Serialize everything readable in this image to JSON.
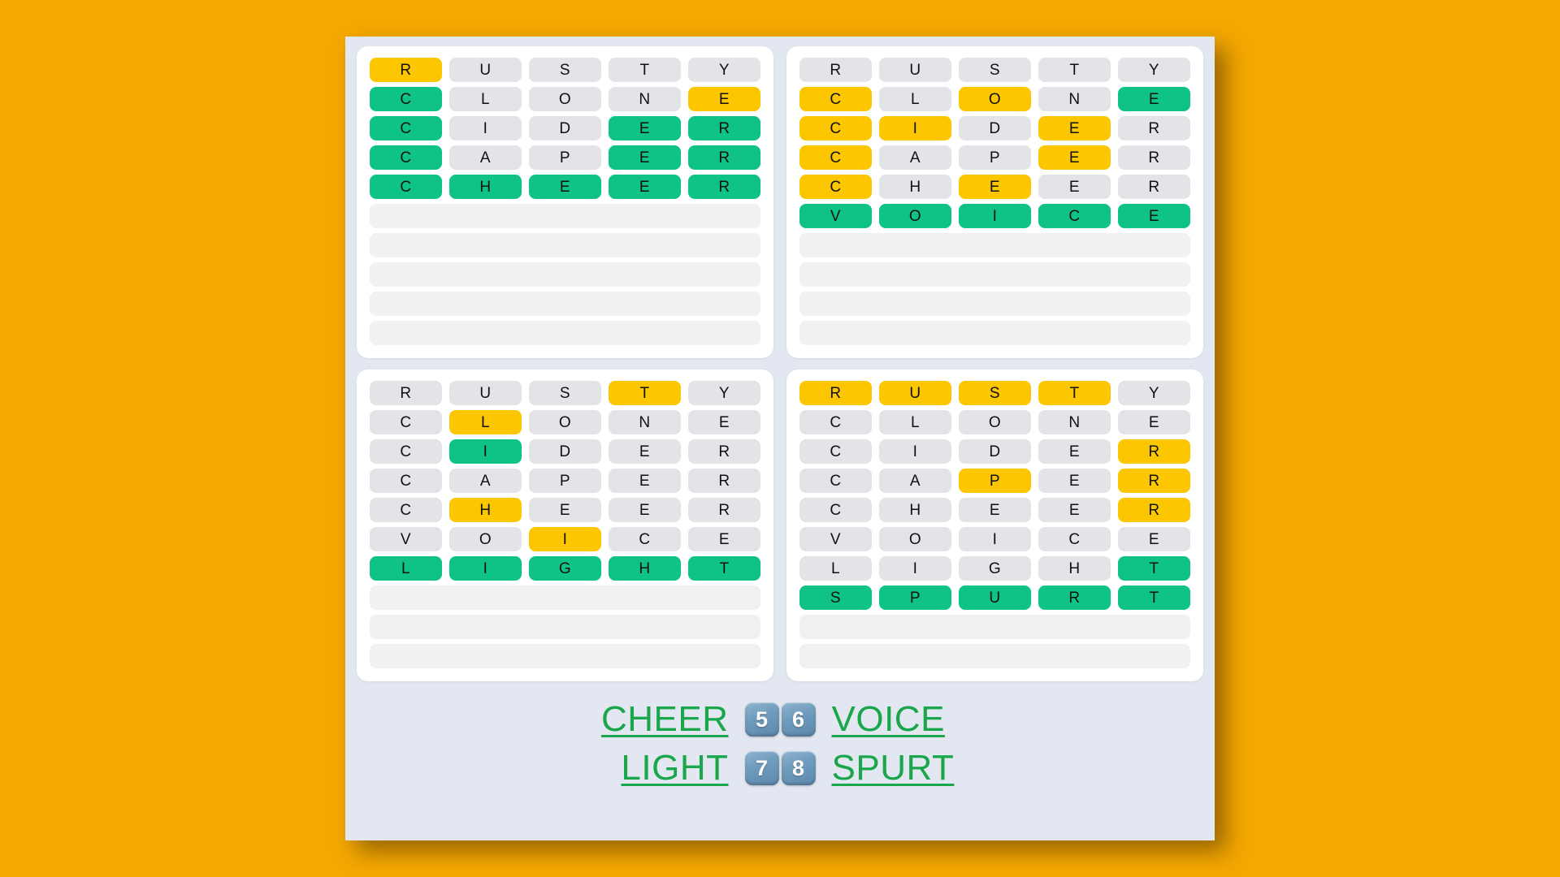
{
  "theme": {
    "page_background": "#f5a800",
    "board_background": "#e3e7f1",
    "card_background": "#ffffff",
    "tile_absent": "#e2e4e8",
    "tile_present": "#fcc700",
    "tile_correct": "#0ec384",
    "blank_row": "#f1f1f1",
    "answer_text": "#1aa64b",
    "badge_text": "#ffffff"
  },
  "boards": [
    {
      "name": "board-1",
      "answer": "CHEER",
      "guess_count": 5,
      "max_rows": 10,
      "rows": [
        {
          "word": "RUSTY",
          "letters": [
            "R",
            "U",
            "S",
            "T",
            "Y"
          ],
          "states": [
            "present",
            "absent",
            "absent",
            "absent",
            "absent"
          ]
        },
        {
          "word": "CLONE",
          "letters": [
            "C",
            "L",
            "O",
            "N",
            "E"
          ],
          "states": [
            "correct",
            "absent",
            "absent",
            "absent",
            "present"
          ]
        },
        {
          "word": "CIDER",
          "letters": [
            "C",
            "I",
            "D",
            "E",
            "R"
          ],
          "states": [
            "correct",
            "absent",
            "absent",
            "correct",
            "correct"
          ]
        },
        {
          "word": "CAPER",
          "letters": [
            "C",
            "A",
            "P",
            "E",
            "R"
          ],
          "states": [
            "correct",
            "absent",
            "absent",
            "correct",
            "correct"
          ]
        },
        {
          "word": "CHEER",
          "letters": [
            "C",
            "H",
            "E",
            "E",
            "R"
          ],
          "states": [
            "correct",
            "correct",
            "correct",
            "correct",
            "correct"
          ]
        }
      ]
    },
    {
      "name": "board-2",
      "answer": "VOICE",
      "guess_count": 6,
      "max_rows": 10,
      "rows": [
        {
          "word": "RUSTY",
          "letters": [
            "R",
            "U",
            "S",
            "T",
            "Y"
          ],
          "states": [
            "absent",
            "absent",
            "absent",
            "absent",
            "absent"
          ]
        },
        {
          "word": "CLONE",
          "letters": [
            "C",
            "L",
            "O",
            "N",
            "E"
          ],
          "states": [
            "present",
            "absent",
            "present",
            "absent",
            "correct"
          ]
        },
        {
          "word": "CIDER",
          "letters": [
            "C",
            "I",
            "D",
            "E",
            "R"
          ],
          "states": [
            "present",
            "present",
            "absent",
            "present",
            "absent"
          ]
        },
        {
          "word": "CAPER",
          "letters": [
            "C",
            "A",
            "P",
            "E",
            "R"
          ],
          "states": [
            "present",
            "absent",
            "absent",
            "present",
            "absent"
          ]
        },
        {
          "word": "CHEER",
          "letters": [
            "C",
            "H",
            "E",
            "E",
            "R"
          ],
          "states": [
            "present",
            "absent",
            "present",
            "absent",
            "absent"
          ]
        },
        {
          "word": "VOICE",
          "letters": [
            "V",
            "O",
            "I",
            "C",
            "E"
          ],
          "states": [
            "correct",
            "correct",
            "correct",
            "correct",
            "correct"
          ]
        }
      ]
    },
    {
      "name": "board-3",
      "answer": "LIGHT",
      "guess_count": 7,
      "max_rows": 10,
      "rows": [
        {
          "word": "RUSTY",
          "letters": [
            "R",
            "U",
            "S",
            "T",
            "Y"
          ],
          "states": [
            "absent",
            "absent",
            "absent",
            "present",
            "absent"
          ]
        },
        {
          "word": "CLONE",
          "letters": [
            "C",
            "L",
            "O",
            "N",
            "E"
          ],
          "states": [
            "absent",
            "present",
            "absent",
            "absent",
            "absent"
          ]
        },
        {
          "word": "CIDER",
          "letters": [
            "C",
            "I",
            "D",
            "E",
            "R"
          ],
          "states": [
            "absent",
            "correct",
            "absent",
            "absent",
            "absent"
          ]
        },
        {
          "word": "CAPER",
          "letters": [
            "C",
            "A",
            "P",
            "E",
            "R"
          ],
          "states": [
            "absent",
            "absent",
            "absent",
            "absent",
            "absent"
          ]
        },
        {
          "word": "CHEER",
          "letters": [
            "C",
            "H",
            "E",
            "E",
            "R"
          ],
          "states": [
            "absent",
            "present",
            "absent",
            "absent",
            "absent"
          ]
        },
        {
          "word": "VOICE",
          "letters": [
            "V",
            "O",
            "I",
            "C",
            "E"
          ],
          "states": [
            "absent",
            "absent",
            "present",
            "absent",
            "absent"
          ]
        },
        {
          "word": "LIGHT",
          "letters": [
            "L",
            "I",
            "G",
            "H",
            "T"
          ],
          "states": [
            "correct",
            "correct",
            "correct",
            "correct",
            "correct"
          ]
        }
      ]
    },
    {
      "name": "board-4",
      "answer": "SPURT",
      "guess_count": 8,
      "max_rows": 10,
      "rows": [
        {
          "word": "RUSTY",
          "letters": [
            "R",
            "U",
            "S",
            "T",
            "Y"
          ],
          "states": [
            "present",
            "present",
            "present",
            "present",
            "absent"
          ]
        },
        {
          "word": "CLONE",
          "letters": [
            "C",
            "L",
            "O",
            "N",
            "E"
          ],
          "states": [
            "absent",
            "absent",
            "absent",
            "absent",
            "absent"
          ]
        },
        {
          "word": "CIDER",
          "letters": [
            "C",
            "I",
            "D",
            "E",
            "R"
          ],
          "states": [
            "absent",
            "absent",
            "absent",
            "absent",
            "present"
          ]
        },
        {
          "word": "CAPER",
          "letters": [
            "C",
            "A",
            "P",
            "E",
            "R"
          ],
          "states": [
            "absent",
            "absent",
            "present",
            "absent",
            "present"
          ]
        },
        {
          "word": "CHEER",
          "letters": [
            "C",
            "H",
            "E",
            "E",
            "R"
          ],
          "states": [
            "absent",
            "absent",
            "absent",
            "absent",
            "present"
          ]
        },
        {
          "word": "VOICE",
          "letters": [
            "V",
            "O",
            "I",
            "C",
            "E"
          ],
          "states": [
            "absent",
            "absent",
            "absent",
            "absent",
            "absent"
          ]
        },
        {
          "word": "LIGHT",
          "letters": [
            "L",
            "I",
            "G",
            "H",
            "T"
          ],
          "states": [
            "absent",
            "absent",
            "absent",
            "absent",
            "correct"
          ]
        },
        {
          "word": "SPURT",
          "letters": [
            "S",
            "P",
            "U",
            "R",
            "T"
          ],
          "states": [
            "correct",
            "correct",
            "correct",
            "correct",
            "correct"
          ]
        }
      ]
    }
  ],
  "footer": {
    "lines": [
      {
        "left_answer": "CHEER",
        "badges": [
          "5",
          "6"
        ],
        "right_answer": "VOICE"
      },
      {
        "left_answer": "LIGHT",
        "badges": [
          "7",
          "8"
        ],
        "right_answer": "SPURT"
      }
    ]
  }
}
